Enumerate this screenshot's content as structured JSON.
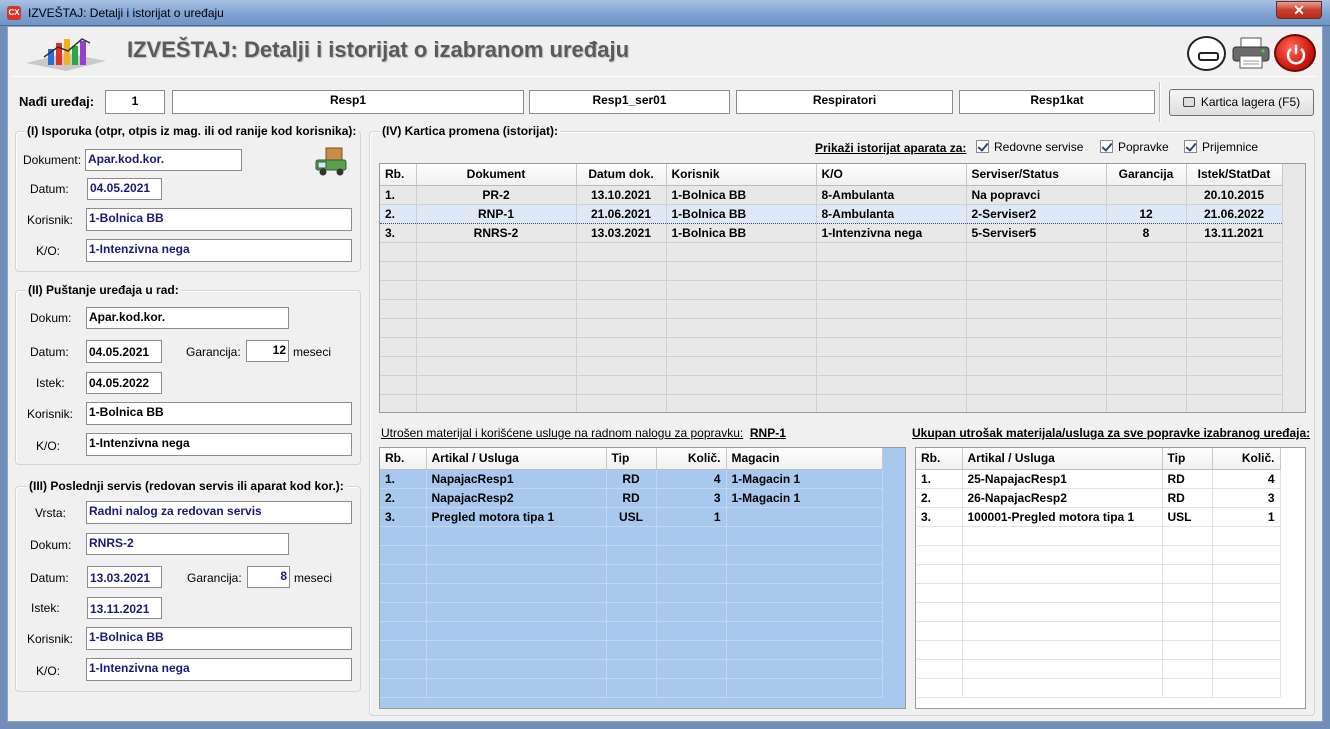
{
  "window": {
    "title": "IZVEŠTAJ: Detalji i istorijat o uređaju",
    "app_icon": "CX",
    "close": "✕"
  },
  "header": {
    "title": "IZVEŠTAJ: Detalji i istorijat o izabranom uređaju"
  },
  "search": {
    "label": "Nađi uređaj:",
    "id": "1",
    "name": "Resp1",
    "serial": "Resp1_ser01",
    "group": "Respiratori",
    "catalog": "Resp1kat"
  },
  "kartica_button": "Kartica lagera (F5)",
  "isporuka": {
    "title": "(I) Isporuka (otpr, otpis iz mag. ili od ranije kod korisnika):",
    "dokument_label": "Dokument:",
    "dokument": "Apar.kod.kor.",
    "datum_label": "Datum:",
    "datum": "04.05.2021",
    "korisnik_label": "Korisnik:",
    "korisnik": "1-Bolnica BB",
    "ko_label": "K/O:",
    "ko": "1-Intenzivna nega"
  },
  "pustanje": {
    "title": "(II) Puštanje uređaja u rad:",
    "dokum_label": "Dokum:",
    "dokum": "Apar.kod.kor.",
    "datum_label": "Datum:",
    "datum": "04.05.2021",
    "garancija_label": "Garancija:",
    "garancija": "12",
    "meseci": "meseci",
    "istek_label": "Istek:",
    "istek": "04.05.2022",
    "korisnik_label": "Korisnik:",
    "korisnik": "1-Bolnica BB",
    "ko_label": "K/O:",
    "ko": "1-Intenzivna nega"
  },
  "servis": {
    "title": "(III) Poslednji servis (redovan servis ili aparat kod kor.):",
    "vrsta_label": "Vrsta:",
    "vrsta": "Radni nalog za redovan servis",
    "dokum_label": "Dokum:",
    "dokum": "RNRS-2",
    "datum_label": "Datum:",
    "datum": "13.03.2021",
    "garancija_label": "Garancija:",
    "garancija": "8",
    "meseci": "meseci",
    "istek_label": "Istek:",
    "istek": "13.11.2021",
    "korisnik_label": "Korisnik:",
    "korisnik": "1-Bolnica BB",
    "ko_label": "K/O:",
    "ko": "1-Intenzivna nega"
  },
  "kartica": {
    "title": "(IV) Kartica promena (istorijat):",
    "filter_label": "Prikaži istorijat aparata za:",
    "filters": [
      "Redovne servise",
      "Popravke",
      "Prijemnice"
    ],
    "columns": [
      "Rb.",
      "Dokument",
      "Datum dok.",
      "Korisnik",
      "K/O",
      "Serviser/Status",
      "Garancija",
      "Istek/StatDat"
    ],
    "rows": [
      [
        "1.",
        "PR-2",
        "13.10.2021",
        "1-Bolnica BB",
        "8-Ambulanta",
        "Na popravci",
        "",
        "20.10.2015"
      ],
      [
        "2.",
        "RNP-1",
        "21.06.2021",
        "1-Bolnica BB",
        "8-Ambulanta",
        "2-Serviser2",
        "12",
        "21.06.2022"
      ],
      [
        "3.",
        "RNRS-2",
        "13.03.2021",
        "1-Bolnica BB",
        "1-Intenzivna nega",
        "5-Serviser5",
        "8",
        "13.11.2021"
      ]
    ]
  },
  "utroseno": {
    "label": "Utrošen materijal i korišćene usluge na radnom nalogu za popravku:",
    "nalog": "RNP-1",
    "columns": [
      "Rb.",
      "Artikal / Usluga",
      "Tip",
      "Količ.",
      "Magacin"
    ],
    "rows": [
      [
        "1.",
        "NapajacResp1",
        "RD",
        "4",
        "1-Magacin 1"
      ],
      [
        "2.",
        "NapajacResp2",
        "RD",
        "3",
        "1-Magacin 1"
      ],
      [
        "3.",
        "Pregled motora tipa 1",
        "USL",
        "1",
        ""
      ]
    ]
  },
  "ukupno": {
    "label": "Ukupan utrošak materijala/usluga za sve popravke izabranog uređaja:",
    "columns": [
      "Rb.",
      "Artikal / Usluga",
      "Tip",
      "Količ."
    ],
    "rows": [
      [
        "1.",
        "25-NapajacResp1",
        "RD",
        "4"
      ],
      [
        "2.",
        "26-NapajacResp2",
        "RD",
        "3"
      ],
      [
        "3.",
        "100001-Pregled motora tipa 1",
        "USL",
        "1"
      ]
    ]
  },
  "colors": {
    "title_blue": "#7fa3d1",
    "grid_blue": "#a9c8ee",
    "navy_text": "#1a1a7a",
    "close_red": "#c8402c"
  },
  "icons": [
    "app-icon",
    "logo-chart-icon",
    "minimize-icon",
    "printer-icon",
    "power-icon",
    "delivery-truck-icon",
    "card-icon"
  ]
}
